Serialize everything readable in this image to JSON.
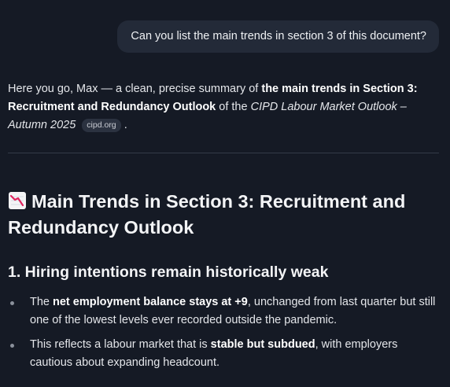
{
  "user_message": "Can you list the main trends in section 3 of this document?",
  "reply": {
    "intro_part1": "Here you go, Max — a clean, precise summary of ",
    "intro_bold": "the main trends in Section 3: Recruitment and Redundancy Outlook",
    "intro_part2": " of the ",
    "intro_italic": "CIPD Labour Market Outlook – Autumn 2025",
    "source_chip": "cipd.org",
    "intro_end": ".",
    "heading_icon": "chart-decreasing-icon",
    "heading": "Main Trends in Section 3: Recruitment and Redundancy Outlook",
    "subheading": "1. Hiring intentions remain historically weak",
    "bullets": [
      {
        "pre": "The ",
        "bold": "net employment balance stays at +9",
        "post": ", unchanged from last quarter but still one of the lowest levels ever recorded outside the pandemic."
      },
      {
        "pre": "This reflects a labour market that is ",
        "bold": "stable but subdued",
        "post": ", with employers cautious about expanding headcount."
      }
    ]
  }
}
